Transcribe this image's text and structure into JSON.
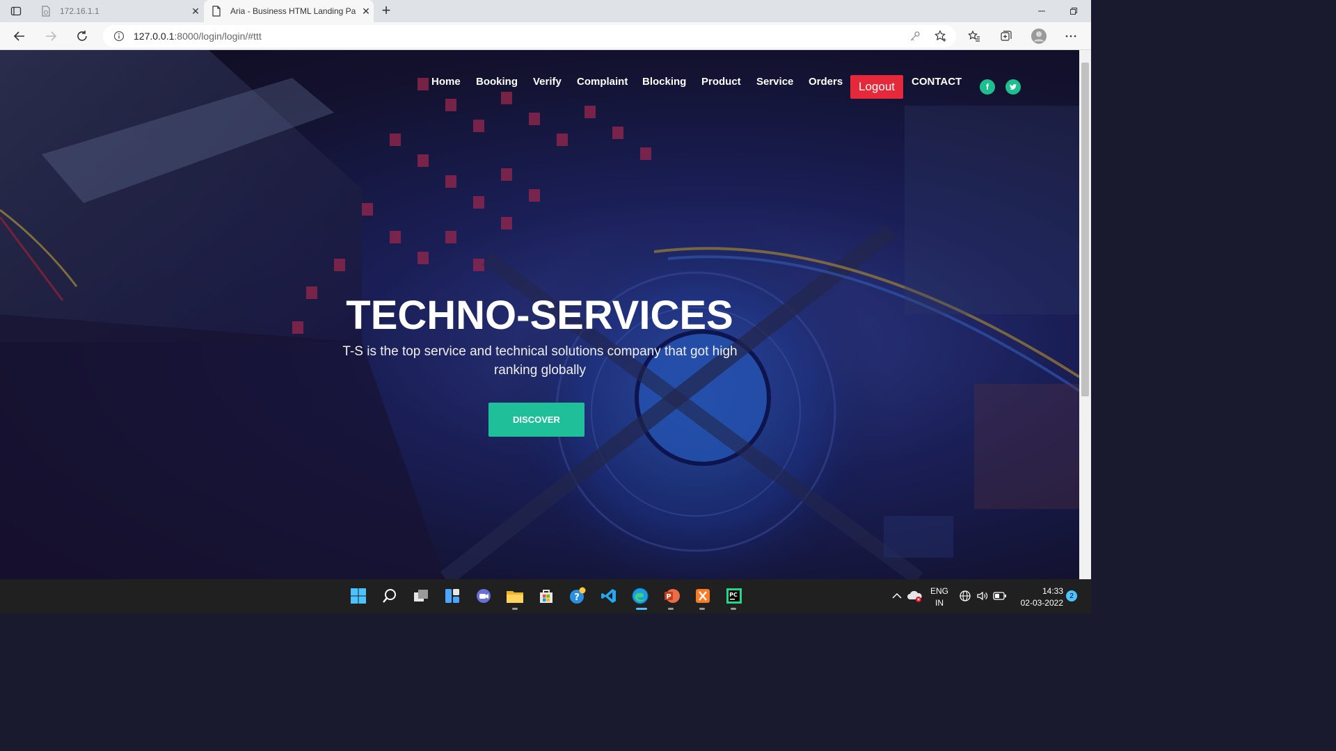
{
  "browser": {
    "tabs": [
      {
        "title": "172.16.1.1",
        "active": false
      },
      {
        "title": "Aria - Business HTML Landing Pa",
        "active": true
      }
    ],
    "new_tab": "+",
    "url_host": "127.0.0.1",
    "url_path": ":8000/login/login/#ttt"
  },
  "nav": {
    "items": [
      "Home",
      "Booking",
      "Verify",
      "Complaint",
      "Blocking",
      "Product",
      "Service",
      "Orders"
    ],
    "logout_label": "Logout",
    "contact_label": "CONTACT",
    "social": [
      {
        "icon": "facebook-icon",
        "glyph": "f"
      },
      {
        "icon": "twitter-icon",
        "glyph": "t"
      }
    ]
  },
  "hero": {
    "title": "TECHNO-SERVICES",
    "subtitle": "T-S is the top service and technical solutions company that got high ranking globally",
    "button_label": "DISCOVER"
  },
  "taskbar": {
    "lang_top": "ENG",
    "lang_bottom": "IN",
    "time": "14:33",
    "date": "02-03-2022",
    "notification_count": "2"
  },
  "colors": {
    "logout_bg": "#e5293a",
    "accent_green": "#1fbf9a",
    "social_bg": "#1dbf8f"
  }
}
